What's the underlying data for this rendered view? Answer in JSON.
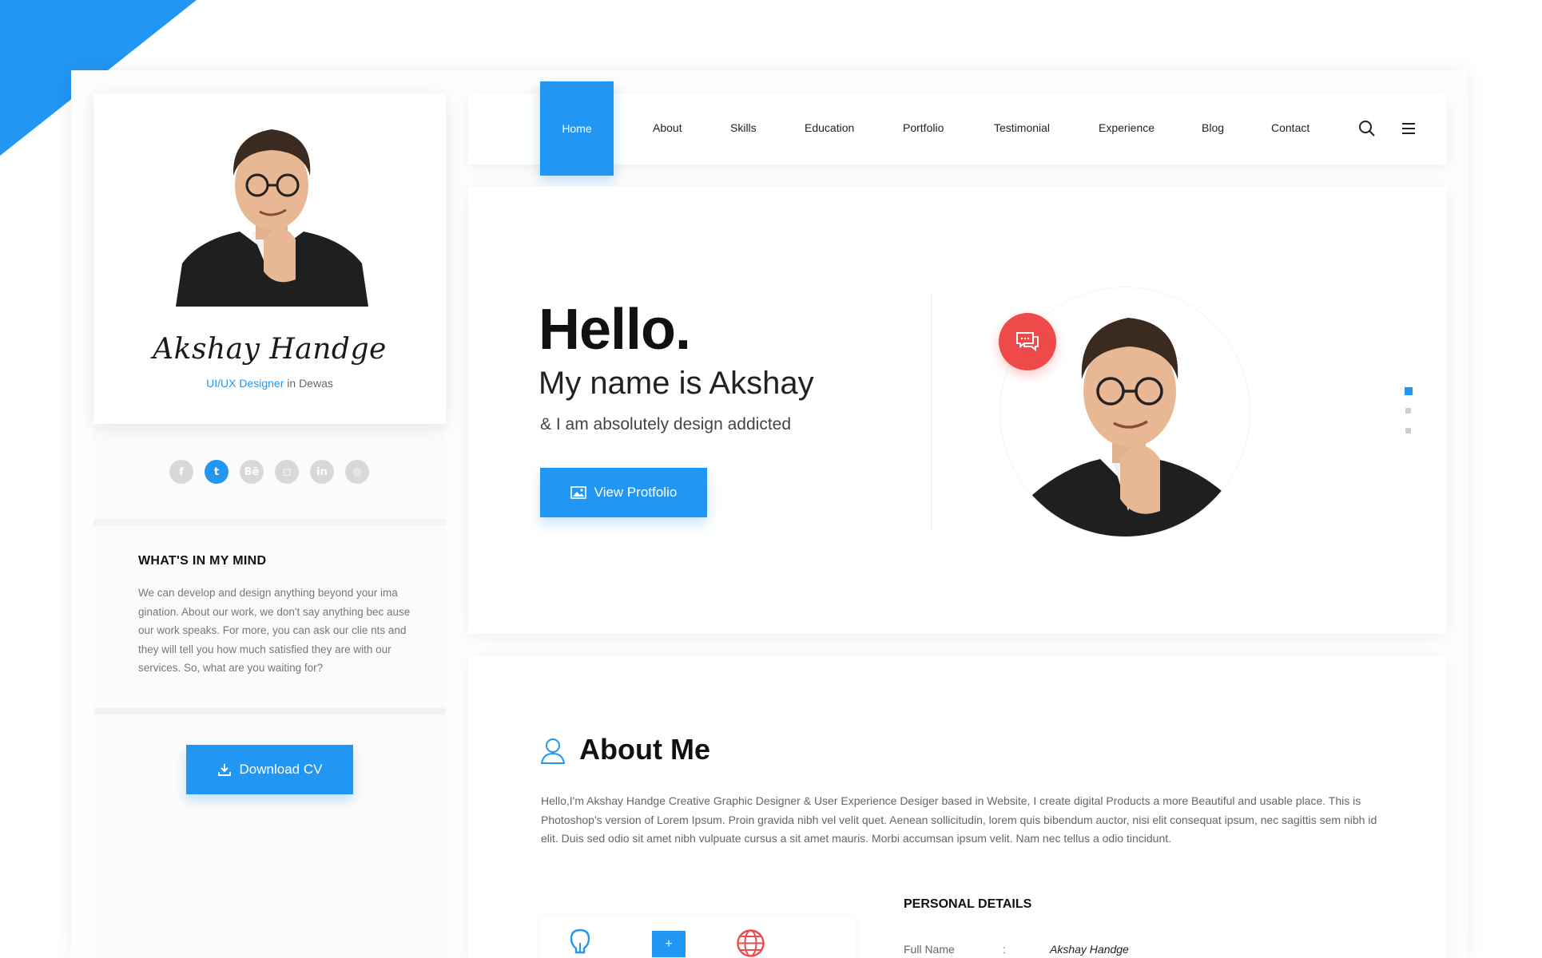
{
  "colors": {
    "accent": "#2196f3",
    "chat": "#ef4a4a"
  },
  "profile": {
    "name": "Akshay Handge",
    "role_accent": "UI/UX Designer",
    "role_rest": " in Dewas"
  },
  "social": [
    {
      "name": "facebook",
      "glyph": "f",
      "active": false
    },
    {
      "name": "twitter",
      "glyph": "t",
      "active": true
    },
    {
      "name": "behance",
      "glyph": "Bē",
      "active": false
    },
    {
      "name": "instagram",
      "glyph": "◻",
      "active": false
    },
    {
      "name": "linkedin",
      "glyph": "in",
      "active": false
    },
    {
      "name": "dribbble",
      "glyph": "◎",
      "active": false
    }
  ],
  "mind": {
    "title": "WHAT'S IN MY MIND",
    "text": "We can develop and design anything beyond your ima gination. About our work, we don't say anything bec ause our work speaks. For more, you can ask our clie nts and they will tell you how much satisfied they are with our services. So, what are you waiting for?"
  },
  "download_label": "Download CV",
  "nav": {
    "home": "Home",
    "items": [
      "About",
      "Skills",
      "Education",
      "Portfolio",
      "Testimonial",
      "Experience",
      "Blog",
      "Contact"
    ]
  },
  "hero": {
    "hello": "Hello.",
    "name": "My name is Akshay",
    "sub": "& I am absolutely design addicted",
    "button": "View Protfolio"
  },
  "about": {
    "title": "About Me",
    "text": "Hello,I'm Akshay Handge Creative Graphic Designer & User Experience Desiger based in Website, I create digital Products a more Beautiful and usable place. This is Photoshop's version  of Lorem Ipsum. Proin gravida nibh vel velit quet. Aenean sollicitudin, lorem quis bibendum auctor, nisi elit consequat ipsum, nec sagittis sem nibh id elit. Duis sed odio sit amet nibh vulpuate cursus a sit amet mauris. Morbi accumsan ipsum velit. Nam nec tellus a odio tincidunt.",
    "personal_title": "PERSONAL DETAILS",
    "full_name_label": "Full Name",
    "colon": ":",
    "full_name_value": "Akshay Handge",
    "plus": "+"
  }
}
